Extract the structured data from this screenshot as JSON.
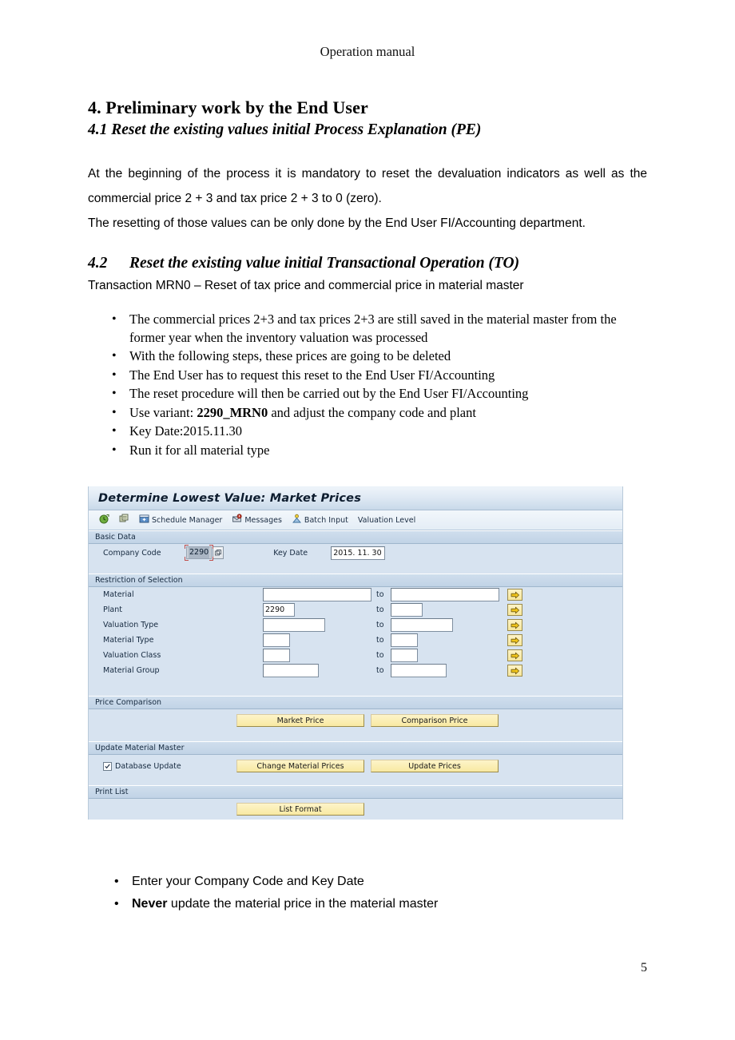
{
  "document": {
    "running_header": "Operation manual",
    "page_number": "5",
    "section_4_title": "4. Preliminary work by the End User",
    "section_41_title": "4.1 Reset the existing values initial Process Explanation (PE)",
    "para_1": "At the beginning of the process it is mandatory to reset the devaluation indicators as well as the commercial price 2 + 3 and tax price 2 + 3 to 0 (zero).",
    "para_2": "The resetting of those values can be only done by the End User FI/Accounting department.",
    "section_42_number": "4.2",
    "section_42_title": "Reset the existing value initial Transactional Operation (TO)",
    "transaction_line": "Transaction MRN0 – Reset of tax price and commercial price in material master",
    "bullets_upper": [
      {
        "text": "The commercial prices 2+3 and tax prices 2+3 are still saved in the material master from the former year when the inventory valuation was processed"
      },
      {
        "text": "With the following steps, these prices are going to be deleted"
      },
      {
        "text": "The End User has to request this reset to the End User FI/Accounting"
      },
      {
        "text": "The reset procedure will then be carried out by the End User FI/Accounting"
      },
      {
        "pre": "Use variant: ",
        "bold": "2290_MRN0",
        "post": " and adjust the company code and plant"
      },
      {
        "text": "Key Date:2015.11.30"
      },
      {
        "text": "Run it for all material type"
      }
    ],
    "bullets_lower": [
      {
        "text": "Enter your Company Code and Key Date"
      },
      {
        "bold": "Never",
        "post": " update the material price in the material master"
      }
    ],
    "bullet_glyph": "•"
  },
  "sap": {
    "window_title": "Determine Lowest Value: Market Prices",
    "toolbar": [
      {
        "name": "execute-icon",
        "label": ""
      },
      {
        "name": "copy-variant-icon",
        "label": ""
      },
      {
        "name": "schedule-manager-icon",
        "label": "Schedule Manager"
      },
      {
        "name": "messages-icon",
        "label": "Messages"
      },
      {
        "name": "batch-input-icon",
        "label": "Batch Input"
      },
      {
        "name": "valuation-level-item",
        "label": "Valuation Level"
      }
    ],
    "basic_data": {
      "section_label": "Basic Data",
      "company_code_label": "Company Code",
      "company_code_value": "2290",
      "key_date_label": "Key Date",
      "key_date_value": "2015. 11. 30"
    },
    "restriction": {
      "section_label": "Restriction of Selection",
      "to_label": "to",
      "rows": [
        {
          "label": "Material",
          "from": "",
          "to": "",
          "from_w": 130,
          "to_w": 130
        },
        {
          "label": "Plant",
          "from": "2290",
          "to": "",
          "from_w": 34,
          "to_w": 34
        },
        {
          "label": "Valuation Type",
          "from": "",
          "to": "",
          "from_w": 72,
          "to_w": 72
        },
        {
          "label": "Material Type",
          "from": "",
          "to": "",
          "from_w": 28,
          "to_w": 28
        },
        {
          "label": "Valuation Class",
          "from": "",
          "to": "",
          "from_w": 28,
          "to_w": 28
        },
        {
          "label": "Material Group",
          "from": "",
          "to": "",
          "from_w": 64,
          "to_w": 64
        }
      ]
    },
    "price_comparison": {
      "section_label": "Price Comparison",
      "market_price_button": "Market Price",
      "comparison_price_button": "Comparison Price"
    },
    "update_material_master": {
      "section_label": "Update Material Master",
      "database_update_label": "Database Update",
      "database_update_checked": true,
      "change_material_prices_button": "Change Material Prices",
      "update_prices_button": "Update Prices"
    },
    "print_list": {
      "section_label": "Print List",
      "list_format_button": "List Format"
    },
    "colors": {
      "panel_bg": "#d7e3f0",
      "section_bar": "#c7d8e9",
      "button_yellow": "#f8e9a2",
      "title_text": "#0d1c2e",
      "focus_marker": "#c0504d"
    }
  }
}
